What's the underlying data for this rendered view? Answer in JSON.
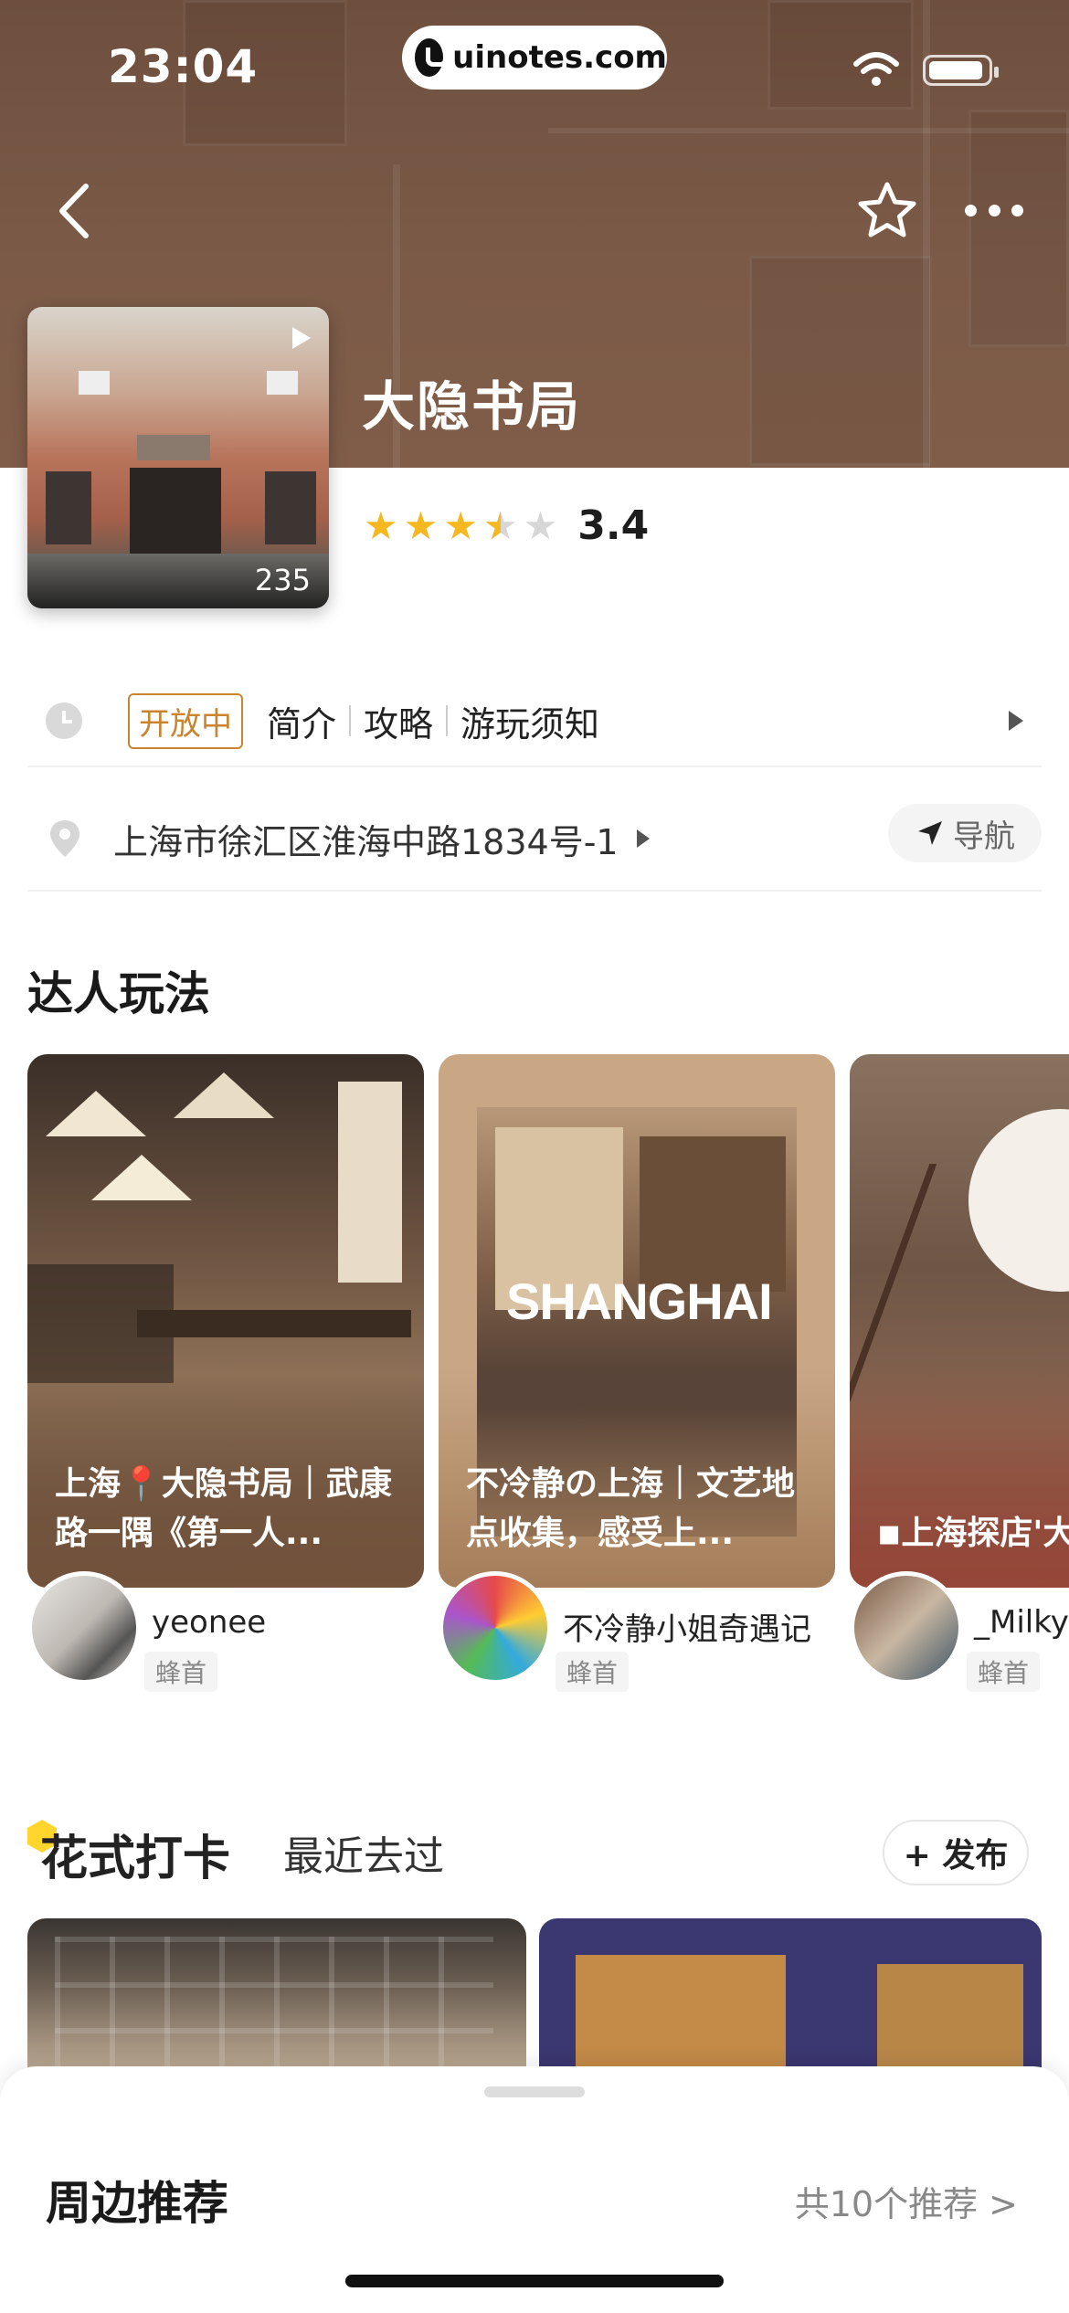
{
  "status_bar": {
    "time": "23:04",
    "url": "uinotes.com"
  },
  "header": {
    "back_icon": "chevron-left-icon",
    "favorite_icon": "star-outline-icon",
    "more_icon": "more-dots-icon"
  },
  "poi": {
    "name": "大隐书局",
    "cover_count": "235",
    "rating": 3.4,
    "rating_text": "3.4",
    "status": "开放中",
    "links": [
      "简介",
      "攻略",
      "游玩须知"
    ],
    "address": "上海市徐汇区淮海中路1834号-1",
    "nav_label": "导航"
  },
  "experts": {
    "title": "达人玩法",
    "cards": [
      {
        "caption": "上海📍大隐书局｜武康路一隅《第一人...",
        "author": "yeonee",
        "badge": "蜂首"
      },
      {
        "caption": "不冷静の上海｜文艺地点收集，感受上...",
        "author": "不冷静小姐奇遇记",
        "badge": "蜂首"
      },
      {
        "caption": "◾上海探店'大隐书局|“大",
        "author": "_Milky",
        "badge": "蜂首"
      }
    ]
  },
  "checkin": {
    "title": "花式打卡",
    "recent": "最近去过",
    "publish": "+ 发布"
  },
  "sheet": {
    "title": "周边推荐",
    "more": "共10个推荐 >"
  },
  "colors": {
    "header_brown": "#7b5a47",
    "star": "#f5b820",
    "badge": "#c9842d"
  }
}
